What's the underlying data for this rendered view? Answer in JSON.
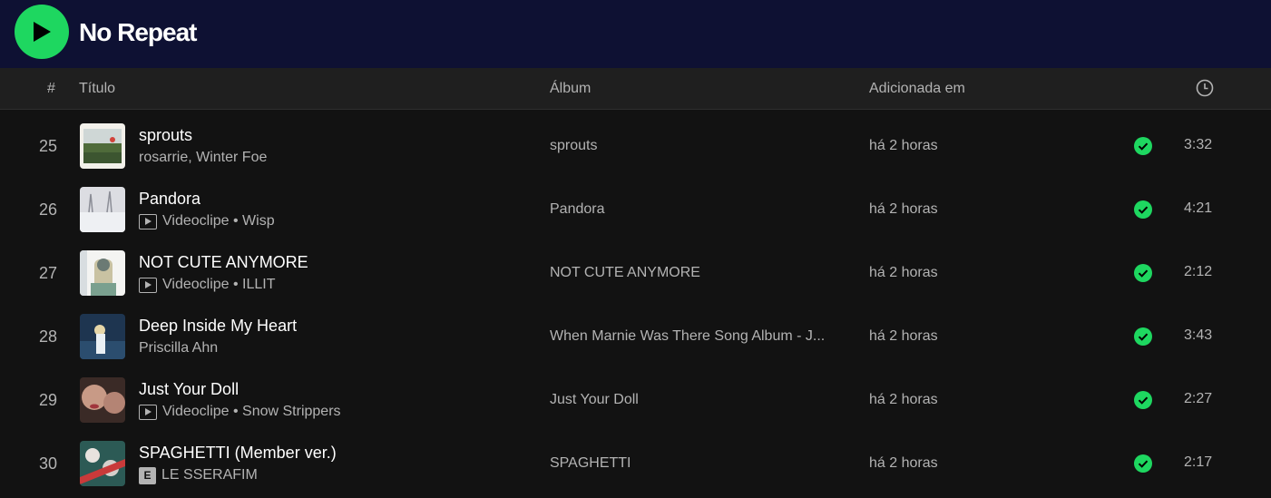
{
  "playlist": {
    "title": "No Repeat"
  },
  "columns": {
    "number": "#",
    "title": "Título",
    "album": "Álbum",
    "added": "Adicionada em"
  },
  "colors": {
    "accent": "#1ed760",
    "topbar": "#0e1133",
    "background": "#121212"
  },
  "tracks": [
    {
      "number": "25",
      "title": "sprouts",
      "subtitle": "rosarrie, Winter Foe",
      "badge": "",
      "album": "sprouts",
      "added": "há 2 horas",
      "duration": "3:32"
    },
    {
      "number": "26",
      "title": "Pandora",
      "subtitle": "Videoclipe • Wisp",
      "badge": "video",
      "album": "Pandora",
      "added": "há 2 horas",
      "duration": "4:21"
    },
    {
      "number": "27",
      "title": "NOT CUTE ANYMORE",
      "subtitle": "Videoclipe • ILLIT",
      "badge": "video",
      "album": "NOT CUTE ANYMORE",
      "added": "há 2 horas",
      "duration": "2:12"
    },
    {
      "number": "28",
      "title": "Deep Inside My Heart",
      "subtitle": "Priscilla Ahn",
      "badge": "",
      "album": "When Marnie Was There Song Album - J...",
      "added": "há 2 horas",
      "duration": "3:43"
    },
    {
      "number": "29",
      "title": "Just Your Doll",
      "subtitle": "Videoclipe • Snow Strippers",
      "badge": "video",
      "album": "Just Your Doll",
      "added": "há 2 horas",
      "duration": "2:27"
    },
    {
      "number": "30",
      "title": "SPAGHETTI (Member ver.)",
      "subtitle": "LE SSERAFIM",
      "badge": "explicit",
      "badge_text": "E",
      "album": "SPAGHETTI",
      "added": "há 2 horas",
      "duration": "2:17"
    }
  ]
}
